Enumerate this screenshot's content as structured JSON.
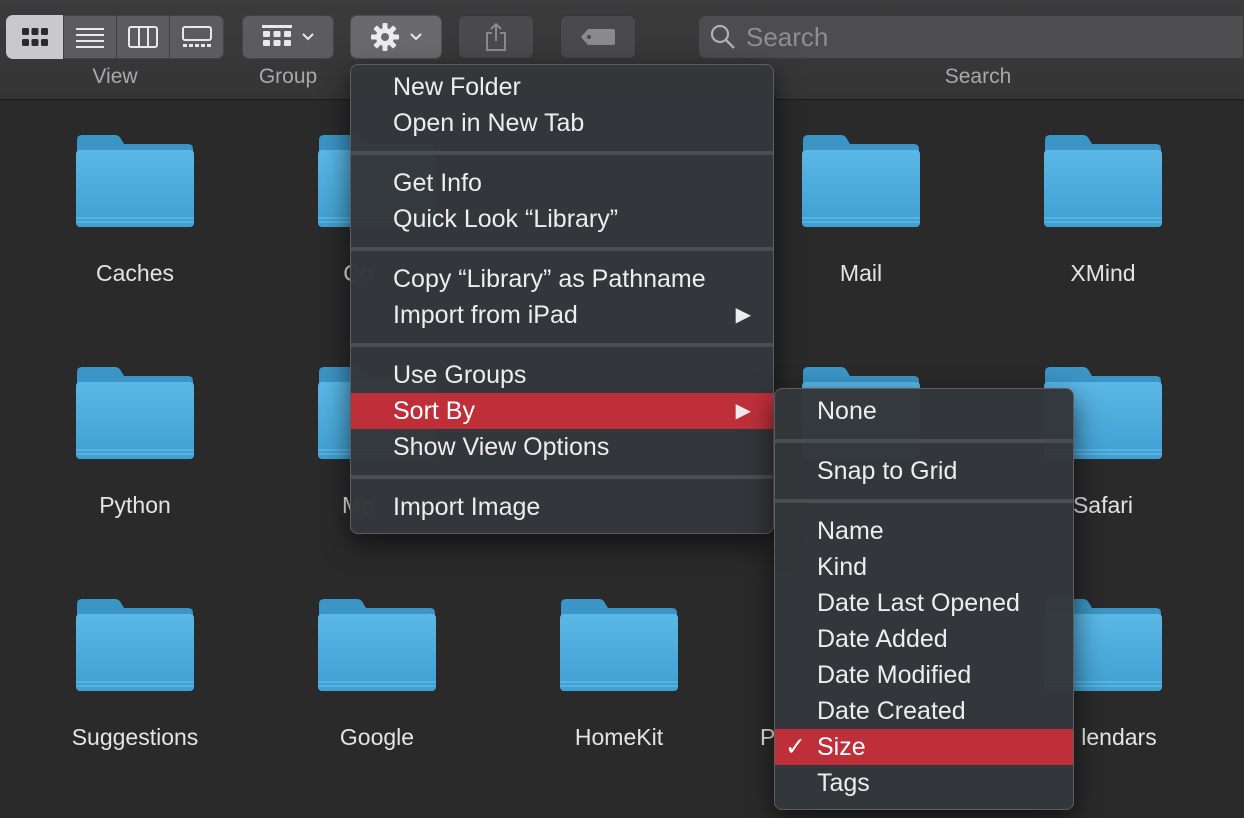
{
  "toolbar": {
    "view_label": "View",
    "group_label": "Group",
    "search_label": "Search",
    "view_modes": [
      "icon-view-icon",
      "list-view-icon",
      "column-view-icon",
      "gallery-view-icon"
    ],
    "active_view_mode": "icon-view-icon",
    "search_placeholder": "Search"
  },
  "folders": [
    {
      "name": "Caches"
    },
    {
      "name": "Co"
    },
    {
      "name": "Mail"
    },
    {
      "name": "XMind"
    },
    {
      "name": "Python"
    },
    {
      "name": "Me"
    },
    {
      "name": "Safari"
    },
    {
      "name": "Suggestions"
    },
    {
      "name": "Google"
    },
    {
      "name": "HomeKit"
    },
    {
      "name": "P"
    },
    {
      "name": "lendars"
    }
  ],
  "context_menu": {
    "items": [
      {
        "label": "New Folder"
      },
      {
        "label": "Open in New Tab"
      },
      {
        "label": "Get Info"
      },
      {
        "label": "Quick Look “Library”"
      },
      {
        "label": "Copy “Library” as Pathname"
      },
      {
        "label": "Import from iPad",
        "submenu_arrow": "▶"
      },
      {
        "label": "Use Groups"
      },
      {
        "label": "Sort By",
        "submenu_arrow": "▶",
        "highlighted": true
      },
      {
        "label": "Show View Options"
      },
      {
        "label": "Import Image"
      }
    ]
  },
  "sort_submenu": {
    "items": [
      {
        "label": "None"
      },
      {
        "label": "Snap to Grid"
      },
      {
        "label": "Name"
      },
      {
        "label": "Kind"
      },
      {
        "label": "Date Last Opened"
      },
      {
        "label": "Date Added"
      },
      {
        "label": "Date Modified"
      },
      {
        "label": "Date Created"
      },
      {
        "label": "Size",
        "checked": true,
        "highlighted": true,
        "check_mark": "✓"
      },
      {
        "label": "Tags"
      }
    ]
  },
  "colors": {
    "highlight": "#bf2f3a",
    "folder_top": "#5bb8e6",
    "folder_bottom": "#3f9fd2",
    "background": "#2a2a2b"
  }
}
